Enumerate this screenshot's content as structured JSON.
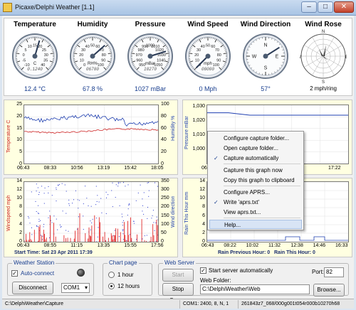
{
  "window": {
    "title": "Picaxe/Delphi Weather [1.1]"
  },
  "gauges": [
    {
      "title": "Temperature",
      "unit": "C",
      "value": "12.4 °C",
      "odometer": "0.1240",
      "ticks": [
        "-10",
        "-5",
        "0",
        "5",
        "10",
        "15",
        "20",
        "25",
        "30",
        "35",
        "40"
      ],
      "level": 0.56
    },
    {
      "title": "Humidity",
      "unit": "RH%",
      "value": "67.8 %",
      "odometer": "06780",
      "ticks": [
        "0",
        "10",
        "20",
        "30",
        "40",
        "50",
        "60",
        "70",
        "80",
        "90",
        "100"
      ],
      "level": 0.68
    },
    {
      "title": "Pressure",
      "unit": "mBar",
      "value": "1027 mBar",
      "odometer": "10270",
      "ticks": [
        "950",
        "960",
        "970",
        "980",
        "990",
        "1000",
        "1010",
        "1020",
        "1030",
        "1040",
        "1050"
      ],
      "level": 0.77
    },
    {
      "title": "Wind Speed",
      "unit": "mph",
      "value": "0 Mph",
      "odometer": "00000",
      "ticks": [
        "0",
        "10",
        "20",
        "30",
        "40",
        "50",
        "60",
        "70",
        "80",
        "90",
        "100"
      ],
      "level": 0.0
    },
    {
      "title": "Wind Direction",
      "unit": "",
      "value": "57°",
      "odometer": "",
      "ticks": [
        "N",
        "",
        "E",
        "",
        "S",
        "",
        "W",
        "",
        "N"
      ],
      "level": 0.16
    },
    {
      "title": "Wind Rose",
      "unit": "",
      "value": "2 mph/ring",
      "odometer": "",
      "ticks": [
        "N",
        "E",
        "S",
        "W"
      ],
      "level": 0
    }
  ],
  "charts": {
    "temp_humidity": {
      "ylabel_left": "Temperature C",
      "ylabel_right": "Humidity %",
      "yticks_left": [
        "0",
        "5",
        "10",
        "15",
        "20",
        "25"
      ],
      "yticks_right": [
        "0",
        "20",
        "40",
        "60",
        "80",
        "100"
      ],
      "xticks": [
        "06:43",
        "08:33",
        "10:56",
        "13:19",
        "15:42",
        "18:05"
      ]
    },
    "pressure": {
      "ylabel": "Pressure mBar",
      "yticks": [
        "1,000",
        "1,010",
        "1,020",
        "1,030"
      ],
      "xticks": [
        "06:43",
        "08:02",
        "17:22"
      ]
    },
    "wind": {
      "ylabel_left": "Windspeed mph",
      "ylabel_right": "Wind direction",
      "yticks_left": [
        "0",
        "2",
        "4",
        "6",
        "8",
        "10",
        "12",
        "14"
      ],
      "yticks_right": [
        "0",
        "50",
        "100",
        "150",
        "200",
        "250",
        "300",
        "350"
      ],
      "xticks": [
        "06:43",
        "08:55",
        "11:15",
        "13:35",
        "15:55",
        "17:56"
      ]
    },
    "rain": {
      "ylabel": "Rain This Hour mm",
      "yticks": [
        "0",
        "2",
        "4",
        "6",
        "8",
        "10",
        "12",
        "14"
      ],
      "xticks": [
        "06:43",
        "08:22",
        "10:02",
        "11:32",
        "12:38",
        "14:46",
        "16:33"
      ]
    },
    "start_time": "Start Time: Sat 23 Apr 2011 17:39",
    "rain_previous": "Rain Previous Hour: 0",
    "rain_this": "Rain This Hour: 0"
  },
  "context_menu": {
    "items": [
      {
        "label": "Configure capture folder...",
        "checked": false
      },
      {
        "label": "Open capture folder...",
        "checked": false
      },
      {
        "label": "Capture automatically",
        "checked": true
      },
      {
        "label": "Capture this graph now",
        "checked": false
      },
      {
        "label": "Copy this graph to clipboard",
        "checked": false
      },
      {
        "label": "Configure APRS...",
        "checked": false
      },
      {
        "label": "Write 'aprs.txt'",
        "checked": true
      },
      {
        "label": "View aprs.txt...",
        "checked": false
      },
      {
        "label": "Help...",
        "checked": false
      }
    ]
  },
  "weather_station": {
    "group_label": "Weather Station",
    "auto_connect_label": "Auto-connect",
    "disconnect_label": "Disconnect",
    "port_value": "COM1"
  },
  "chart_page": {
    "group_label": "Chart page",
    "option_1": "1 hour",
    "option_12": "12 hours",
    "selected": "12 hours"
  },
  "web_server": {
    "group_label": "Web Server",
    "start_label": "Start Server",
    "stop_label": "Stop Server",
    "auto_label": "Start server automatically",
    "port_label": "Port:",
    "port_value": "82",
    "folder_label": "Web Folder:",
    "folder_value": "C:\\DelphiWeather\\Web",
    "browse_label": "Browse..."
  },
  "status_bar": {
    "path": "C:\\DelphiWeather\\Capture",
    "com": "COM1: 2400, 8, N, 1",
    "raw": "261843z7_068/000g001t054r000b10270h68"
  },
  "colors": {
    "temp_series": "#cc2222",
    "humidity_series": "#1f3fb0",
    "wind_series": "#dd1111",
    "dir_series": "#2233cc"
  }
}
